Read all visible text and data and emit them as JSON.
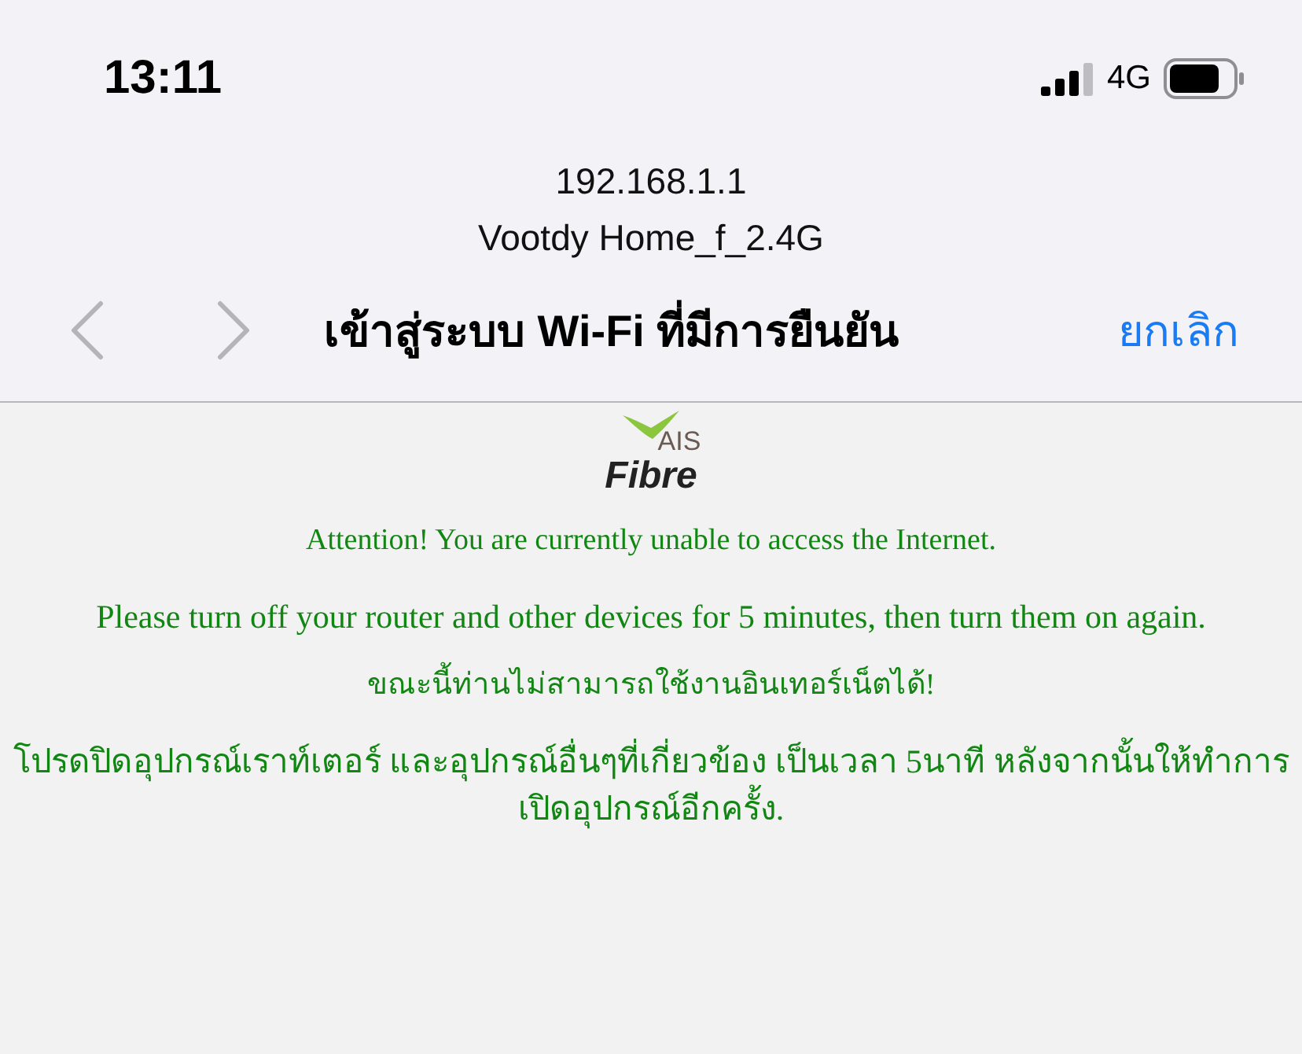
{
  "status_bar": {
    "time": "13:11",
    "network": "4G"
  },
  "header": {
    "address": "192.168.1.1",
    "network_name": "Vootdy Home_f_2.4G"
  },
  "nav": {
    "back": {
      "disabled": true
    },
    "forward": {
      "disabled": true
    },
    "title": "เข้าสู่ระบบ Wi-Fi ที่มีการยืนยัน",
    "cancel": "ยกเลิก"
  },
  "logo": {
    "brand": "AIS",
    "product": "Fibre"
  },
  "messages": [
    {
      "kind": "heading",
      "text": "Attention! You are currently unable to access the Internet."
    },
    {
      "kind": "paragraph",
      "text": "Please turn off your router and other devices for 5 minutes, then turn them on again."
    },
    {
      "kind": "heading",
      "text": "ขณะนี้ท่านไม่สามารถใช้งานอินเทอร์เน็ตได้!"
    },
    {
      "kind": "paragraph",
      "text": "โปรดปิดอุปกรณ์เราท์เตอร์ และอุปกรณ์อื่นๆที่เกี่ยวข้อง เป็นเวลา 5นาที หลังจากนั้นให้ทำการเปิดอุปกรณ์อีกครั้ง."
    }
  ]
}
